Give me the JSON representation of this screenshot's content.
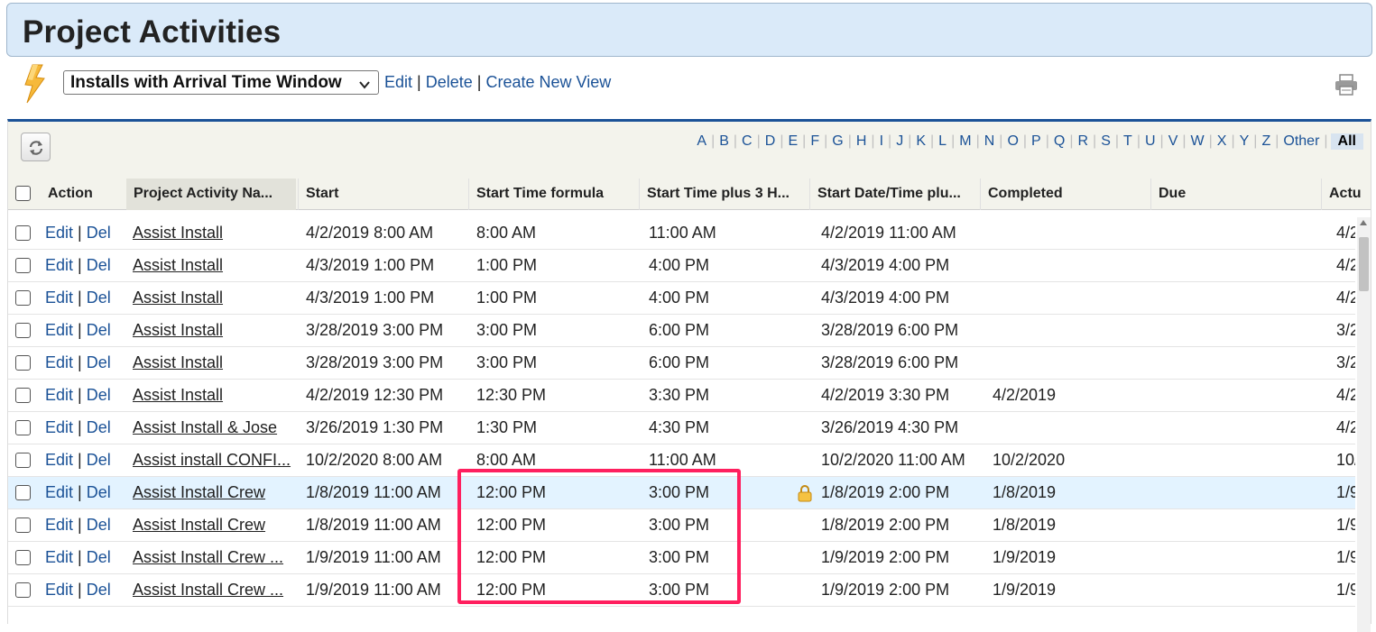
{
  "header": {
    "title": "Project Activities"
  },
  "view": {
    "selected": "Installs with Arrival Time Window",
    "edit": "Edit",
    "delete": "Delete",
    "create_new": "Create New View",
    "separator": "|"
  },
  "alphabet": [
    "A",
    "B",
    "C",
    "D",
    "E",
    "F",
    "G",
    "H",
    "I",
    "J",
    "K",
    "L",
    "M",
    "N",
    "O",
    "P",
    "Q",
    "R",
    "S",
    "T",
    "U",
    "V",
    "W",
    "X",
    "Y",
    "Z",
    "Other",
    "All"
  ],
  "alphabet_active": "All",
  "columns": {
    "action": "Action",
    "name": "Project Activity Na...",
    "start": "Start",
    "start_time_formula": "Start Time formula",
    "start_plus3": "Start Time plus 3 H...",
    "start_datetime_plus": "Start Date/Time plu...",
    "completed": "Completed",
    "due": "Due",
    "actual": "Actu"
  },
  "row_actions": {
    "edit": "Edit",
    "sep": "|",
    "del": "Del"
  },
  "rows": [
    {
      "name": "Assist Install",
      "start": "4/2/2019 8:00 AM",
      "start_time": "8:00 AM",
      "plus3": "11:00 AM",
      "datetime_plus": "4/2/2019 11:00 AM",
      "completed": "",
      "due": "",
      "actual": "4/2"
    },
    {
      "name": "Assist Install",
      "start": "4/3/2019 1:00 PM",
      "start_time": "1:00 PM",
      "plus3": "4:00 PM",
      "datetime_plus": "4/3/2019 4:00 PM",
      "completed": "",
      "due": "",
      "actual": "4/2"
    },
    {
      "name": "Assist Install",
      "start": "4/3/2019 1:00 PM",
      "start_time": "1:00 PM",
      "plus3": "4:00 PM",
      "datetime_plus": "4/3/2019 4:00 PM",
      "completed": "",
      "due": "",
      "actual": "4/2"
    },
    {
      "name": "Assist Install",
      "start": "3/28/2019 3:00 PM",
      "start_time": "3:00 PM",
      "plus3": "6:00 PM",
      "datetime_plus": "3/28/2019 6:00 PM",
      "completed": "",
      "due": "",
      "actual": "3/2"
    },
    {
      "name": "Assist Install",
      "start": "3/28/2019 3:00 PM",
      "start_time": "3:00 PM",
      "plus3": "6:00 PM",
      "datetime_plus": "3/28/2019 6:00 PM",
      "completed": "",
      "due": "",
      "actual": "3/2"
    },
    {
      "name": "Assist Install",
      "start": "4/2/2019 12:30 PM",
      "start_time": "12:30 PM",
      "plus3": "3:30 PM",
      "datetime_plus": "4/2/2019 3:30 PM",
      "completed": "4/2/2019",
      "due": "",
      "actual": "4/2"
    },
    {
      "name": "Assist Install & Jose",
      "start": "3/26/2019 1:30 PM",
      "start_time": "1:30 PM",
      "plus3": "4:30 PM",
      "datetime_plus": "3/26/2019 4:30 PM",
      "completed": "",
      "due": "",
      "actual": "4/2"
    },
    {
      "name": "Assist install CONFI...",
      "start": "10/2/2020 8:00 AM",
      "start_time": "8:00 AM",
      "plus3": "11:00 AM",
      "datetime_plus": "10/2/2020 11:00 AM",
      "completed": "10/2/2020",
      "due": "",
      "actual": "10/"
    },
    {
      "name": "Assist Install Crew",
      "start": "1/8/2019 11:00 AM",
      "start_time": "12:00 PM",
      "plus3": "3:00 PM",
      "datetime_plus": "1/8/2019 2:00 PM",
      "completed": "1/8/2019",
      "due": "",
      "actual": "1/9",
      "locked": true,
      "highlight": true
    },
    {
      "name": "Assist Install Crew",
      "start": "1/8/2019 11:00 AM",
      "start_time": "12:00 PM",
      "plus3": "3:00 PM",
      "datetime_plus": "1/8/2019 2:00 PM",
      "completed": "1/8/2019",
      "due": "",
      "actual": "1/9"
    },
    {
      "name": "Assist Install Crew ...",
      "start": "1/9/2019 11:00 AM",
      "start_time": "12:00 PM",
      "plus3": "3:00 PM",
      "datetime_plus": "1/9/2019 2:00 PM",
      "completed": "1/9/2019",
      "due": "",
      "actual": "1/9"
    },
    {
      "name": "Assist Install Crew ...",
      "start": "1/9/2019 11:00 AM",
      "start_time": "12:00 PM",
      "plus3": "3:00 PM",
      "datetime_plus": "1/9/2019 2:00 PM",
      "completed": "1/9/2019",
      "due": "",
      "actual": "1/9"
    }
  ],
  "colors": {
    "accent": "#1b5297",
    "header_bg": "#daeaf9",
    "callout": "#ff1f5e",
    "row_highlight": "#e3f3ff"
  },
  "icons": {
    "app": "lightning-bolt-icon",
    "print": "printer-icon",
    "refresh": "refresh-icon",
    "lock": "lock-icon"
  }
}
